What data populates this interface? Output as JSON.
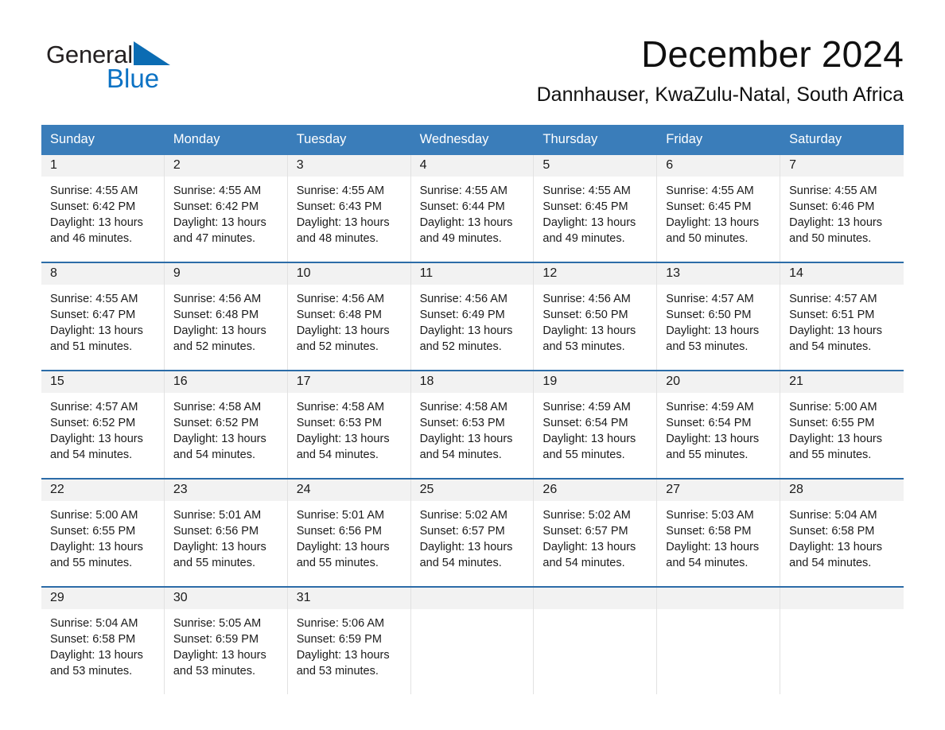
{
  "brand": {
    "name_part1": "General",
    "name_part2": "Blue",
    "triangle_color": "#0b6cb3",
    "blue_text_color": "#0b72c4"
  },
  "header": {
    "title": "December 2024",
    "location": "Dannhauser, KwaZulu-Natal, South Africa"
  },
  "theme": {
    "header_row_bg": "#3a7dba",
    "week_divider": "#2c6ca8",
    "daynum_band_bg": "#f2f2f2",
    "cell_border": "#e2e2e2",
    "text_color": "#1b1b1b"
  },
  "calendar": {
    "weekdays": [
      "Sunday",
      "Monday",
      "Tuesday",
      "Wednesday",
      "Thursday",
      "Friday",
      "Saturday"
    ],
    "weeks": [
      [
        {
          "day": "1",
          "sunrise": "Sunrise: 4:55 AM",
          "sunset": "Sunset: 6:42 PM",
          "daylight": "Daylight: 13 hours and 46 minutes."
        },
        {
          "day": "2",
          "sunrise": "Sunrise: 4:55 AM",
          "sunset": "Sunset: 6:42 PM",
          "daylight": "Daylight: 13 hours and 47 minutes."
        },
        {
          "day": "3",
          "sunrise": "Sunrise: 4:55 AM",
          "sunset": "Sunset: 6:43 PM",
          "daylight": "Daylight: 13 hours and 48 minutes."
        },
        {
          "day": "4",
          "sunrise": "Sunrise: 4:55 AM",
          "sunset": "Sunset: 6:44 PM",
          "daylight": "Daylight: 13 hours and 49 minutes."
        },
        {
          "day": "5",
          "sunrise": "Sunrise: 4:55 AM",
          "sunset": "Sunset: 6:45 PM",
          "daylight": "Daylight: 13 hours and 49 minutes."
        },
        {
          "day": "6",
          "sunrise": "Sunrise: 4:55 AM",
          "sunset": "Sunset: 6:45 PM",
          "daylight": "Daylight: 13 hours and 50 minutes."
        },
        {
          "day": "7",
          "sunrise": "Sunrise: 4:55 AM",
          "sunset": "Sunset: 6:46 PM",
          "daylight": "Daylight: 13 hours and 50 minutes."
        }
      ],
      [
        {
          "day": "8",
          "sunrise": "Sunrise: 4:55 AM",
          "sunset": "Sunset: 6:47 PM",
          "daylight": "Daylight: 13 hours and 51 minutes."
        },
        {
          "day": "9",
          "sunrise": "Sunrise: 4:56 AM",
          "sunset": "Sunset: 6:48 PM",
          "daylight": "Daylight: 13 hours and 52 minutes."
        },
        {
          "day": "10",
          "sunrise": "Sunrise: 4:56 AM",
          "sunset": "Sunset: 6:48 PM",
          "daylight": "Daylight: 13 hours and 52 minutes."
        },
        {
          "day": "11",
          "sunrise": "Sunrise: 4:56 AM",
          "sunset": "Sunset: 6:49 PM",
          "daylight": "Daylight: 13 hours and 52 minutes."
        },
        {
          "day": "12",
          "sunrise": "Sunrise: 4:56 AM",
          "sunset": "Sunset: 6:50 PM",
          "daylight": "Daylight: 13 hours and 53 minutes."
        },
        {
          "day": "13",
          "sunrise": "Sunrise: 4:57 AM",
          "sunset": "Sunset: 6:50 PM",
          "daylight": "Daylight: 13 hours and 53 minutes."
        },
        {
          "day": "14",
          "sunrise": "Sunrise: 4:57 AM",
          "sunset": "Sunset: 6:51 PM",
          "daylight": "Daylight: 13 hours and 54 minutes."
        }
      ],
      [
        {
          "day": "15",
          "sunrise": "Sunrise: 4:57 AM",
          "sunset": "Sunset: 6:52 PM",
          "daylight": "Daylight: 13 hours and 54 minutes."
        },
        {
          "day": "16",
          "sunrise": "Sunrise: 4:58 AM",
          "sunset": "Sunset: 6:52 PM",
          "daylight": "Daylight: 13 hours and 54 minutes."
        },
        {
          "day": "17",
          "sunrise": "Sunrise: 4:58 AM",
          "sunset": "Sunset: 6:53 PM",
          "daylight": "Daylight: 13 hours and 54 minutes."
        },
        {
          "day": "18",
          "sunrise": "Sunrise: 4:58 AM",
          "sunset": "Sunset: 6:53 PM",
          "daylight": "Daylight: 13 hours and 54 minutes."
        },
        {
          "day": "19",
          "sunrise": "Sunrise: 4:59 AM",
          "sunset": "Sunset: 6:54 PM",
          "daylight": "Daylight: 13 hours and 55 minutes."
        },
        {
          "day": "20",
          "sunrise": "Sunrise: 4:59 AM",
          "sunset": "Sunset: 6:54 PM",
          "daylight": "Daylight: 13 hours and 55 minutes."
        },
        {
          "day": "21",
          "sunrise": "Sunrise: 5:00 AM",
          "sunset": "Sunset: 6:55 PM",
          "daylight": "Daylight: 13 hours and 55 minutes."
        }
      ],
      [
        {
          "day": "22",
          "sunrise": "Sunrise: 5:00 AM",
          "sunset": "Sunset: 6:55 PM",
          "daylight": "Daylight: 13 hours and 55 minutes."
        },
        {
          "day": "23",
          "sunrise": "Sunrise: 5:01 AM",
          "sunset": "Sunset: 6:56 PM",
          "daylight": "Daylight: 13 hours and 55 minutes."
        },
        {
          "day": "24",
          "sunrise": "Sunrise: 5:01 AM",
          "sunset": "Sunset: 6:56 PM",
          "daylight": "Daylight: 13 hours and 55 minutes."
        },
        {
          "day": "25",
          "sunrise": "Sunrise: 5:02 AM",
          "sunset": "Sunset: 6:57 PM",
          "daylight": "Daylight: 13 hours and 54 minutes."
        },
        {
          "day": "26",
          "sunrise": "Sunrise: 5:02 AM",
          "sunset": "Sunset: 6:57 PM",
          "daylight": "Daylight: 13 hours and 54 minutes."
        },
        {
          "day": "27",
          "sunrise": "Sunrise: 5:03 AM",
          "sunset": "Sunset: 6:58 PM",
          "daylight": "Daylight: 13 hours and 54 minutes."
        },
        {
          "day": "28",
          "sunrise": "Sunrise: 5:04 AM",
          "sunset": "Sunset: 6:58 PM",
          "daylight": "Daylight: 13 hours and 54 minutes."
        }
      ],
      [
        {
          "day": "29",
          "sunrise": "Sunrise: 5:04 AM",
          "sunset": "Sunset: 6:58 PM",
          "daylight": "Daylight: 13 hours and 53 minutes."
        },
        {
          "day": "30",
          "sunrise": "Sunrise: 5:05 AM",
          "sunset": "Sunset: 6:59 PM",
          "daylight": "Daylight: 13 hours and 53 minutes."
        },
        {
          "day": "31",
          "sunrise": "Sunrise: 5:06 AM",
          "sunset": "Sunset: 6:59 PM",
          "daylight": "Daylight: 13 hours and 53 minutes."
        },
        {
          "day": "",
          "sunrise": "",
          "sunset": "",
          "daylight": ""
        },
        {
          "day": "",
          "sunrise": "",
          "sunset": "",
          "daylight": ""
        },
        {
          "day": "",
          "sunrise": "",
          "sunset": "",
          "daylight": ""
        },
        {
          "day": "",
          "sunrise": "",
          "sunset": "",
          "daylight": ""
        }
      ]
    ]
  }
}
